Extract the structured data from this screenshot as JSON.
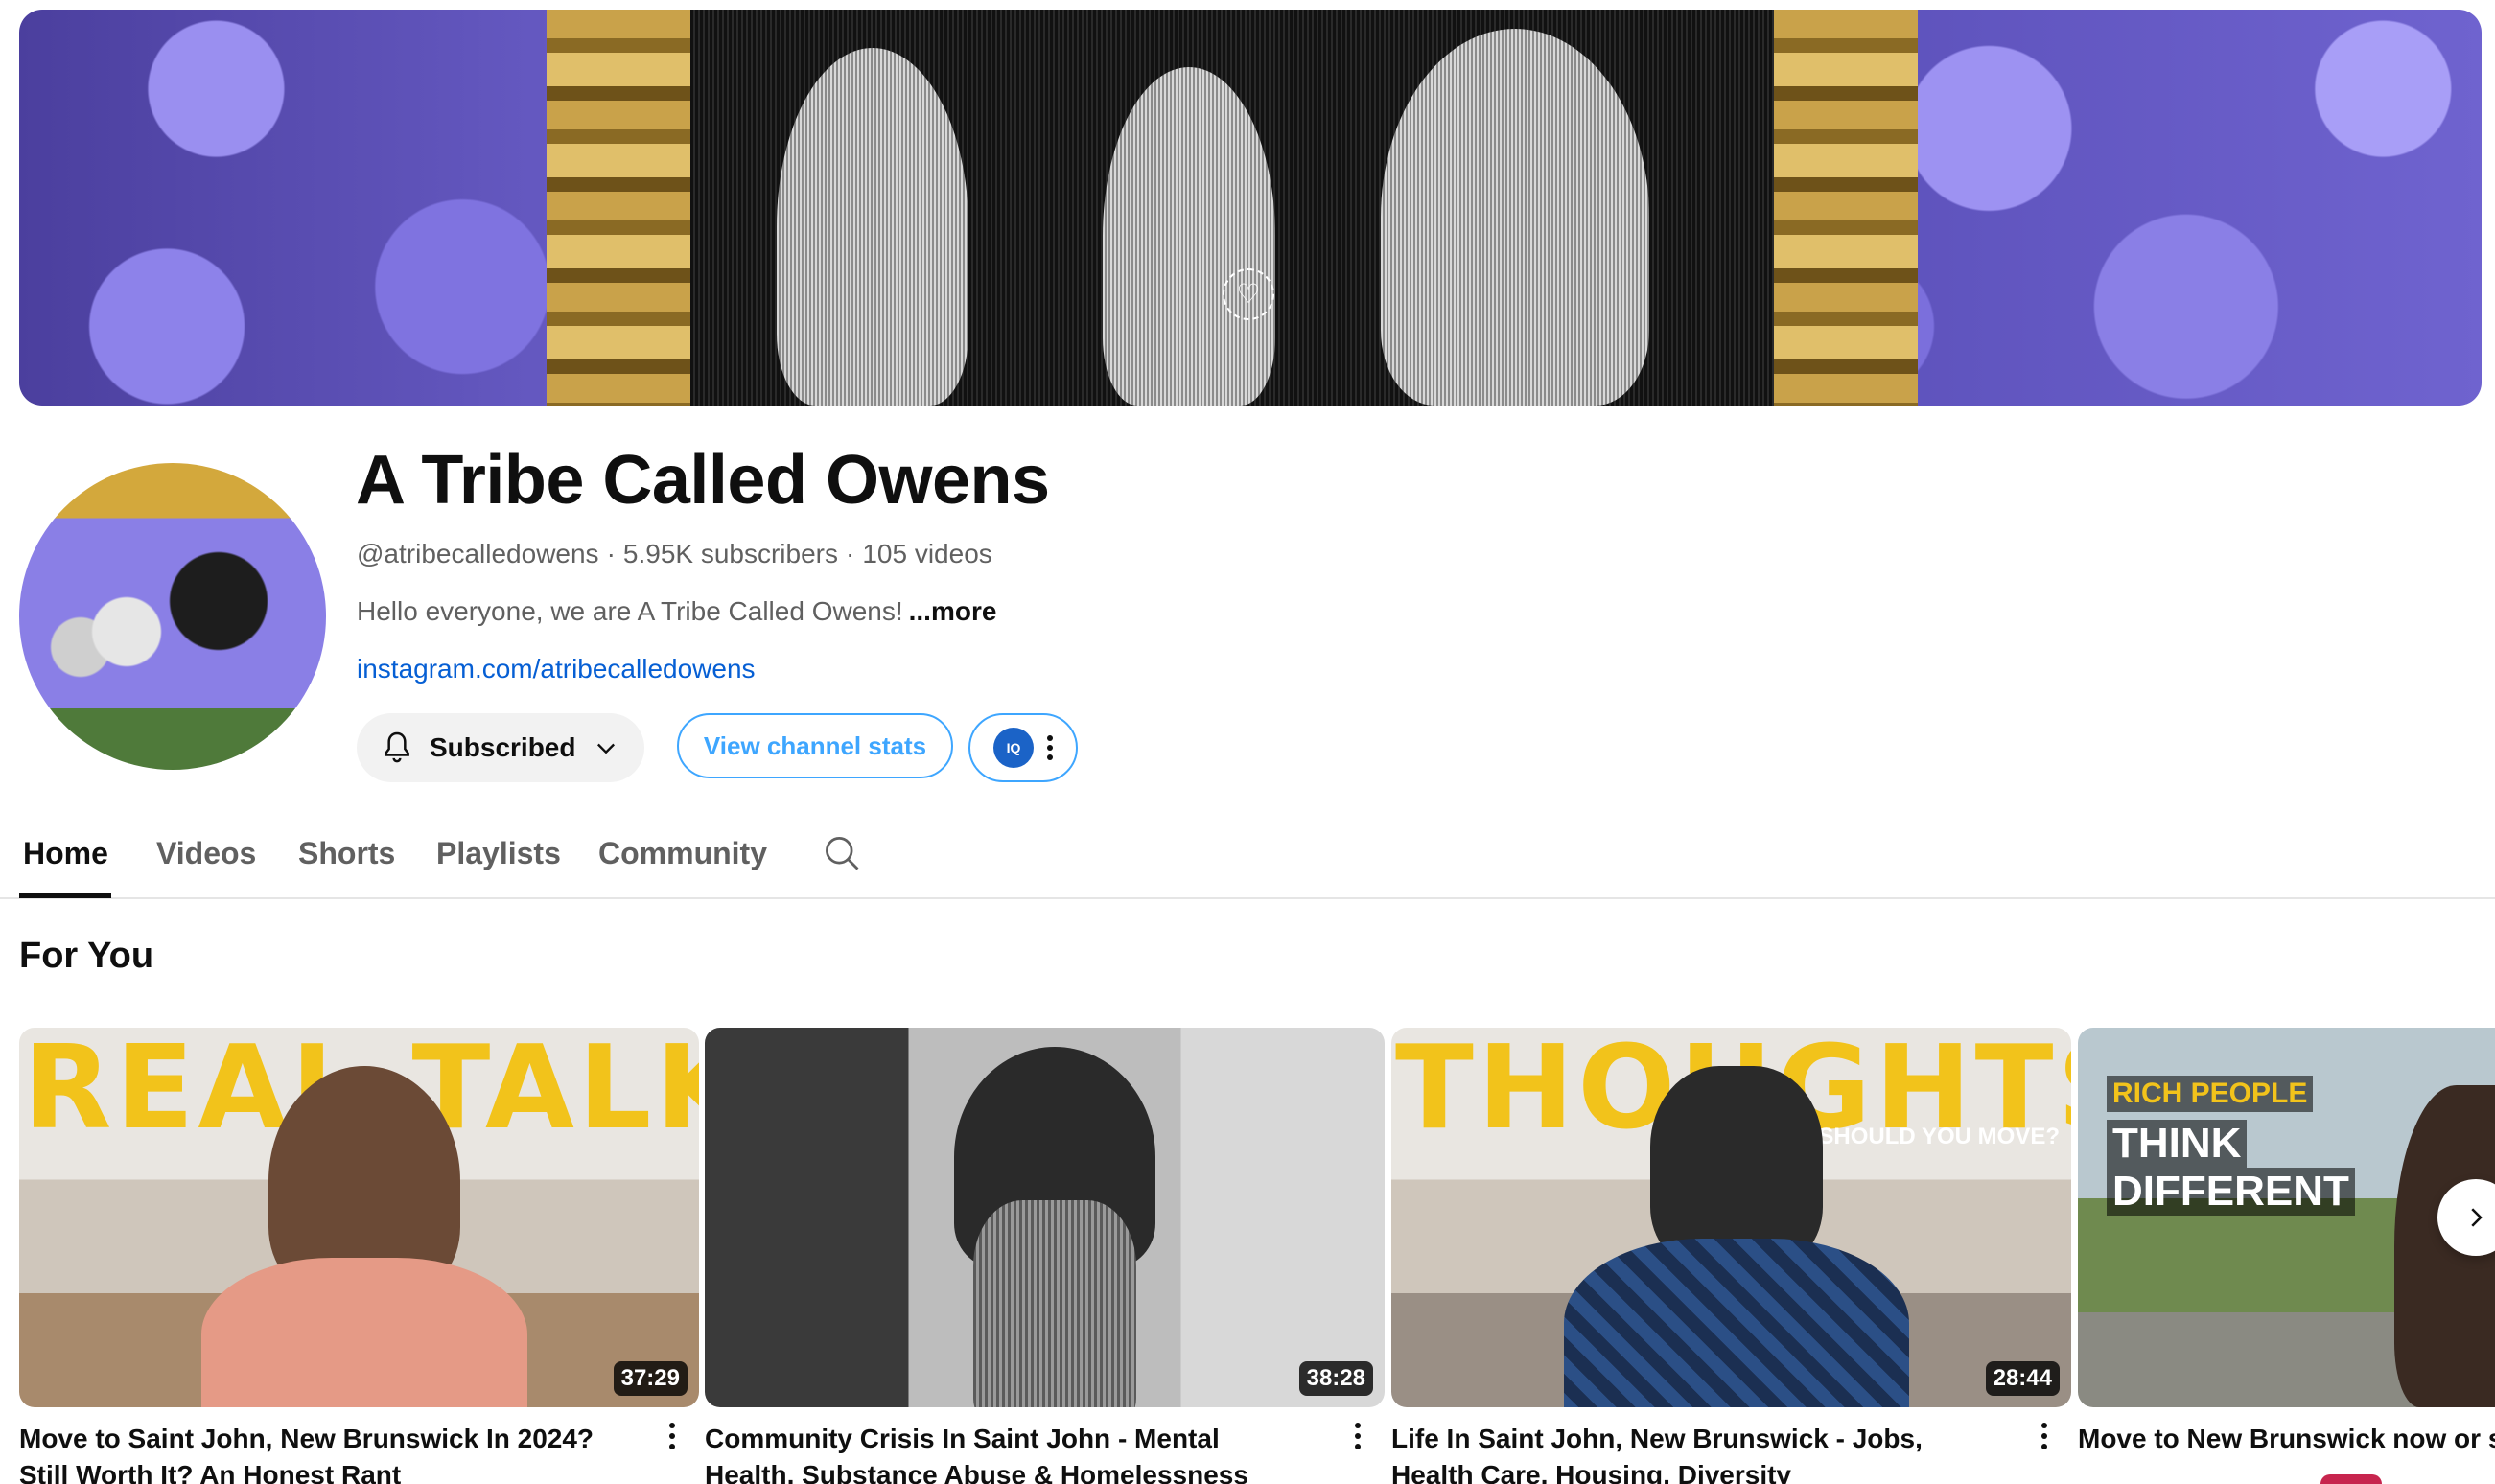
{
  "banner": {
    "icon": "heart-icon"
  },
  "channel": {
    "name": "A Tribe Called Owens",
    "handle": "@atribecalledowens",
    "subscribers": "5.95K subscribers",
    "videos": "105 videos",
    "separator": "·",
    "description": "Hello everyone, we are A Tribe Called Owens!",
    "more_label": "...more",
    "link": "instagram.com/atribecalledowens"
  },
  "actions": {
    "subscribed_label": "Subscribed",
    "view_stats_label": "View channel stats",
    "extension_logo_text": "IQ"
  },
  "tabs": [
    {
      "label": "Home",
      "active": true
    },
    {
      "label": "Videos"
    },
    {
      "label": "Shorts"
    },
    {
      "label": "Playlists"
    },
    {
      "label": "Community"
    }
  ],
  "section": {
    "title": "For You"
  },
  "videos": [
    {
      "thumb_text": "REAL TALK",
      "duration": "37:29",
      "title": "Move to Saint John, New Brunswick In 2024? Still Worth It? An Honest Rant"
    },
    {
      "duration": "38:28",
      "title": "Community Crisis In Saint John - Mental Health, Substance Abuse & Homelessness"
    },
    {
      "thumb_text": "THOUGHTS",
      "thumb_subtext": "SHOULD YOU MOVE?",
      "duration": "28:44",
      "title": "Life In Saint John, New Brunswick - Jobs, Health Care, Housing, Diversity"
    },
    {
      "thumb_lines": [
        "RICH PEOPLE",
        "THINK",
        "DIFFERENT"
      ],
      "title": "Move to New Brunswick now or st"
    }
  ],
  "colors": {
    "accent_blue": "#3ea6ff",
    "link_blue": "#065fd4",
    "thumb_yellow": "#f2c31b"
  }
}
